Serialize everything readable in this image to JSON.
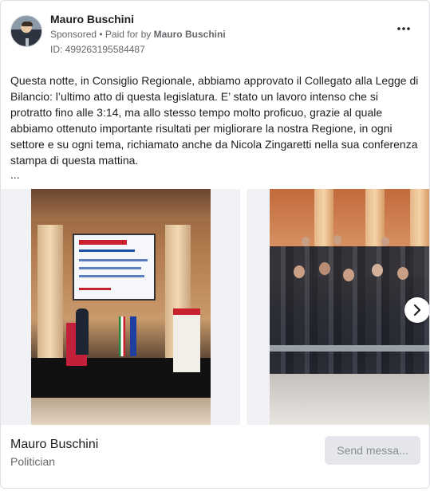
{
  "post": {
    "author": "Mauro Buschini",
    "sponsored_label": "Sponsored",
    "paid_for_prefix": "• Paid for by",
    "paid_for_by": "Mauro Buschini",
    "ad_id": "ID: 499263195584487",
    "more_icon": "more-horizontal-icon",
    "text": "Questa notte, in Consiglio Regionale, abbiamo approvato il Collegato alla Legge di Bilancio: l’ultimo atto di questa legislatura. E’ stato un lavoro intenso che si protratto fino alle 3:14, ma allo stesso tempo molto proficuo, grazie al quale abbiamo ottenuto importante risultati per migliorare la nostra Regione, in ogni settore e su ogni tema, richiamato anche da Nicola Zingaretti nella sua conferenza stampa di questa mattina.",
    "ellipsis": "..."
  },
  "carousel": {
    "next_icon": "chevron-right-icon"
  },
  "footer": {
    "page_name": "Mauro Buschini",
    "page_category": "Politician",
    "send_button": "Send messa..."
  },
  "colors": {
    "text": "#1c1e21",
    "secondary": "#65676b",
    "button_bg": "#e4e6eb",
    "button_text": "#8a8d91"
  }
}
